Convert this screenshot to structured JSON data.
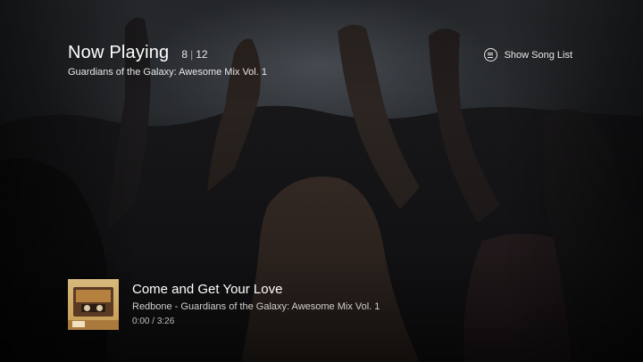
{
  "header": {
    "title": "Now Playing",
    "track_position": "8",
    "track_total": "12",
    "album": "Guardians of the Galaxy: Awesome Mix Vol. 1"
  },
  "song_list_button": {
    "label": "Show Song List",
    "icon": "list-circle-icon"
  },
  "now_playing": {
    "title": "Come and Get Your Love",
    "subtitle": "Redbone - Guardians of the Galaxy: Awesome Mix Vol. 1",
    "elapsed": "0:00",
    "duration": "3:26",
    "album_art_icon": "cassette-album-art"
  },
  "colors": {
    "text_primary": "#ffffff",
    "text_secondary": "#cfcfcf",
    "background": "#121114"
  }
}
